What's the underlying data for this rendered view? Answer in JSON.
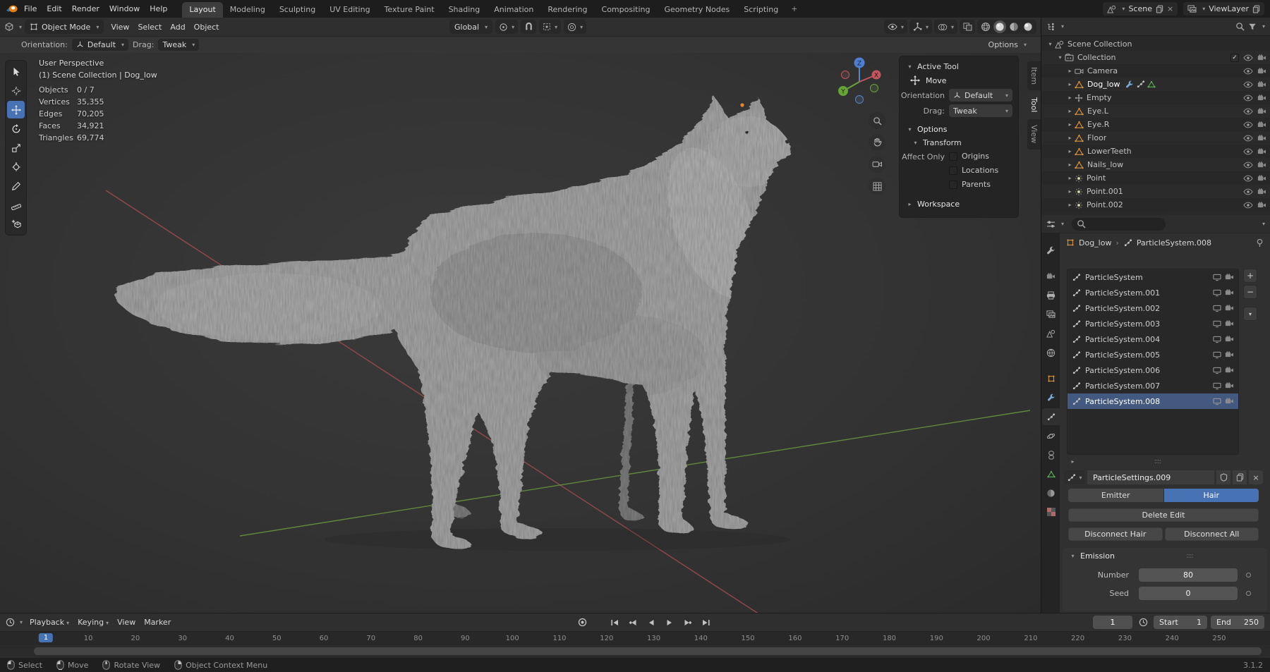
{
  "topbar": {
    "menus": [
      "File",
      "Edit",
      "Render",
      "Window",
      "Help"
    ],
    "workspaces": [
      "Layout",
      "Modeling",
      "Sculpting",
      "UV Editing",
      "Texture Paint",
      "Shading",
      "Animation",
      "Rendering",
      "Compositing",
      "Geometry Nodes",
      "Scripting"
    ],
    "active_workspace": "Layout",
    "new_workspace_label": "+",
    "scene_name": "Scene",
    "view_layer_name": "ViewLayer"
  },
  "viewport_header": {
    "mode": "Object Mode",
    "menus": [
      "View",
      "Select",
      "Add",
      "Object"
    ],
    "orientation": "Global",
    "shading_modes": [
      "wireframe",
      "solid",
      "material",
      "rendered"
    ],
    "active_shading": "solid"
  },
  "tool_settings": {
    "orientation_label": "Orientation:",
    "orientation_value": "Default",
    "drag_label": "Drag:",
    "drag_value": "Tweak",
    "options_label": "Options"
  },
  "left_toolbar": {
    "tools": [
      "select-box",
      "cursor",
      "move",
      "rotate",
      "scale",
      "transform",
      "annotate",
      "measure",
      "add-cube"
    ],
    "active_tool": "move"
  },
  "viewport": {
    "perspective_label": "User Perspective",
    "context_label": "(1) Scene Collection | Dog_low",
    "stats": [
      {
        "label": "Objects",
        "value": "0 / 7"
      },
      {
        "label": "Vertices",
        "value": "35,355"
      },
      {
        "label": "Edges",
        "value": "70,205"
      },
      {
        "label": "Faces",
        "value": "34,921"
      },
      {
        "label": "Triangles",
        "value": "69,774"
      }
    ],
    "gizmo_axes": [
      "X",
      "Y",
      "Z"
    ]
  },
  "npanel": {
    "active_tool_section": "Active Tool",
    "tool_name": "Move",
    "orientation_label": "Orientation",
    "orientation_value": "Default",
    "drag_label": "Drag:",
    "drag_value": "Tweak",
    "options_section": "Options",
    "transform_section": "Transform",
    "affect_only_label": "Affect Only",
    "affect_only_options": [
      "Origins",
      "Locations",
      "Parents"
    ],
    "workspace_section": "Workspace",
    "tabs": [
      "Item",
      "Tool",
      "View"
    ],
    "active_tab": "Tool"
  },
  "outliner": {
    "scene_collection": "Scene Collection",
    "collection": "Collection",
    "items": [
      {
        "name": "Camera",
        "type": "camera"
      },
      {
        "name": "Dog_low",
        "type": "mesh",
        "active": true
      },
      {
        "name": "Empty",
        "type": "empty"
      },
      {
        "name": "Eye.L",
        "type": "mesh"
      },
      {
        "name": "Eye.R",
        "type": "mesh"
      },
      {
        "name": "Floor",
        "type": "mesh"
      },
      {
        "name": "LowerTeeth",
        "type": "mesh"
      },
      {
        "name": "Nails_low",
        "type": "mesh"
      },
      {
        "name": "Point",
        "type": "light"
      },
      {
        "name": "Point.001",
        "type": "light"
      },
      {
        "name": "Point.002",
        "type": "light"
      }
    ]
  },
  "properties": {
    "tabs": [
      "tool",
      "render",
      "output",
      "view-layer",
      "scene",
      "world",
      "object",
      "modifiers",
      "particles",
      "physics",
      "constraints",
      "data",
      "material",
      "texture"
    ],
    "active_tab": "particles",
    "breadcrumb": {
      "object": "Dog_low",
      "datablock": "ParticleSystem.008"
    },
    "particle_systems": [
      "ParticleSystem",
      "ParticleSystem.001",
      "ParticleSystem.002",
      "ParticleSystem.003",
      "ParticleSystem.004",
      "ParticleSystem.005",
      "ParticleSystem.006",
      "ParticleSystem.007",
      "ParticleSystem.008"
    ],
    "selected_system": "ParticleSystem.008",
    "settings_name": "ParticleSettings.009",
    "type_options": [
      "Emitter",
      "Hair"
    ],
    "active_type": "Hair",
    "delete_edit_label": "Delete Edit",
    "disconnect_hair_label": "Disconnect Hair",
    "disconnect_all_label": "Disconnect All",
    "emission_section": "Emission",
    "emission_fields": [
      {
        "label": "Number",
        "value": "80"
      },
      {
        "label": "Seed",
        "value": "0"
      }
    ]
  },
  "timeline": {
    "menus": [
      "Playback",
      "Keying",
      "View",
      "Marker"
    ],
    "current_frame": "1",
    "frame_start": 1,
    "frame_end": 250,
    "ruler_step": 10,
    "start_label": "Start",
    "start_value": "1",
    "end_label": "End",
    "end_value": "250"
  },
  "statusbar": {
    "hints": [
      {
        "button": "lmb",
        "label": "Select"
      },
      {
        "button": "lmb-drag",
        "label": "Move"
      },
      {
        "button": "mmb",
        "label": "Rotate View"
      },
      {
        "button": "rmb",
        "label": "Object Context Menu"
      }
    ],
    "version": "3.1.2"
  }
}
